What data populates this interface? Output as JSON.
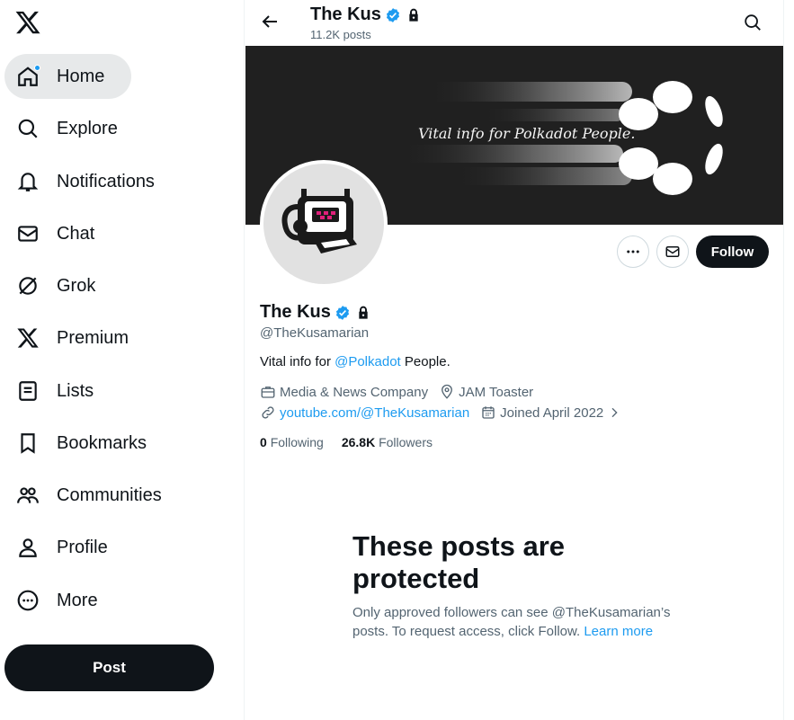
{
  "sidebar": {
    "logo": "x-logo-icon",
    "items": [
      {
        "label": "Home",
        "icon": "home-icon"
      },
      {
        "label": "Explore",
        "icon": "search-icon"
      },
      {
        "label": "Notifications",
        "icon": "bell-icon"
      },
      {
        "label": "Chat",
        "icon": "envelope-icon"
      },
      {
        "label": "Grok",
        "icon": "grok-icon"
      },
      {
        "label": "Premium",
        "icon": "x-logo-icon"
      },
      {
        "label": "Lists",
        "icon": "list-icon"
      },
      {
        "label": "Bookmarks",
        "icon": "bookmark-icon"
      },
      {
        "label": "Communities",
        "icon": "communities-icon"
      },
      {
        "label": "Profile",
        "icon": "person-icon"
      },
      {
        "label": "More",
        "icon": "more-circle-icon"
      }
    ],
    "post_label": "Post"
  },
  "header": {
    "name": "The Kus",
    "post_count": "11.2K posts"
  },
  "banner": {
    "tagline": "Vital info for Polkadot People."
  },
  "profile": {
    "name": "The Kus",
    "handle": "@TheKusamarian",
    "bio_prefix": "Vital info for ",
    "bio_mention": "@Polkadot",
    "bio_suffix": " People.",
    "category": "Media & News Company",
    "location": "JAM Toaster",
    "website": "youtube.com/@TheKusamarian",
    "joined": "Joined April 2022",
    "following_count": "0",
    "following_label": "Following",
    "followers_count": "26.8K",
    "followers_label": "Followers",
    "follow_label": "Follow"
  },
  "protected": {
    "title": "These posts are protected",
    "text": "Only approved followers can see @TheKusamarian’s posts. To request access, click Follow.",
    "learn_more": "Learn more"
  },
  "colors": {
    "accent": "#1d9bf0",
    "text": "#0f1419",
    "muted": "#536471"
  }
}
